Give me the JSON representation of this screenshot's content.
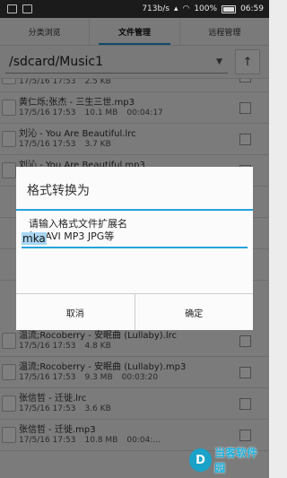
{
  "status_bar": {
    "speed": "713b/s",
    "battery": "100%",
    "time": "06:59"
  },
  "tabs": [
    {
      "label": "分类浏览",
      "active": false
    },
    {
      "label": "文件管理",
      "active": true
    },
    {
      "label": "远程管理",
      "active": false
    }
  ],
  "path": {
    "value": "/sdcard/Music1"
  },
  "files": [
    {
      "name": "",
      "date": "17/5/16 17:53",
      "size": "2.5 KB",
      "duration": ""
    },
    {
      "name": "黄仁烁;张杰 - 三生三世.mp3",
      "date": "17/5/16 17:53",
      "size": "10.1 MB",
      "duration": "00:04:17"
    },
    {
      "name": "刘沁 - You Are Beautiful.lrc",
      "date": "17/5/16 17:53",
      "size": "3.7 KB",
      "duration": ""
    },
    {
      "name": "刘沁 - You Are Beautiful.mp3",
      "date": "",
      "size": "",
      "duration": ""
    },
    {
      "name": "",
      "date": "",
      "size": "",
      "duration": ""
    },
    {
      "name": "",
      "date": "",
      "size": "",
      "duration": ""
    },
    {
      "name": "",
      "date": "",
      "size": "",
      "duration": ""
    },
    {
      "name": "温流;Rocoberry - 安眠曲 (Lullaby).lrc",
      "date": "17/5/16 17:53",
      "size": "4.8 KB",
      "duration": ""
    },
    {
      "name": "温流;Rocoberry - 安眠曲 (Lullaby).mp3",
      "date": "17/5/16 17:53",
      "size": "9.3 MB",
      "duration": "00:03:20"
    },
    {
      "name": "张信哲 - 迁徙.lrc",
      "date": "17/5/16 17:53",
      "size": "3.6 KB",
      "duration": ""
    },
    {
      "name": "张信哲 - 迁徙.mp3",
      "date": "17/5/16 17:53",
      "size": "10.8 MB",
      "duration": "00:04:..."
    }
  ],
  "dialog": {
    "title": "格式转换为",
    "message_line1": "请输入格式文件扩展名",
    "message_line2": "如: AVI MP3 JPG等",
    "input_value": "mka",
    "cancel_label": "取消",
    "ok_label": "确定"
  },
  "watermark": {
    "text": "当客软件园",
    "mark": "D"
  },
  "colors": {
    "accent": "#27a3dd",
    "statusbar": "#1b1b1b"
  }
}
